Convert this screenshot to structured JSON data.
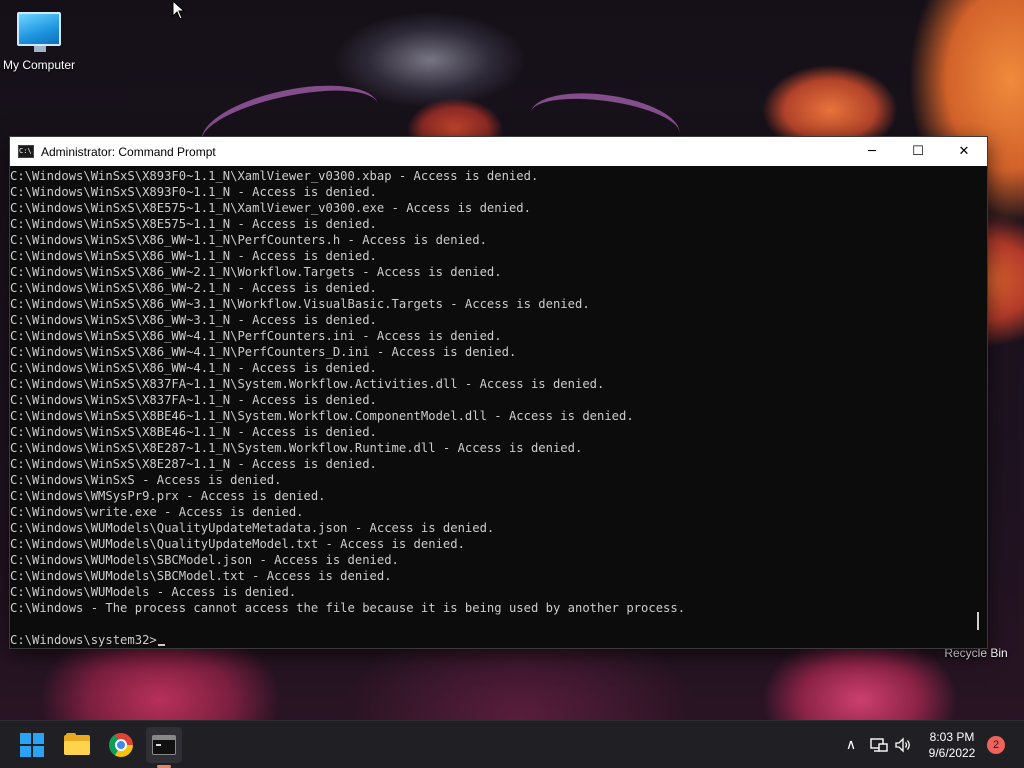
{
  "desktop": {
    "icons": [
      {
        "label": "My Computer"
      },
      {
        "label": "Recycle Bin"
      }
    ]
  },
  "window": {
    "title": "Administrator: Command Prompt",
    "icon_text": "C:\\",
    "controls": {
      "minimize": "─",
      "maximize": "☐",
      "close": "✕"
    }
  },
  "console": {
    "lines": [
      "C:\\Windows\\WinSxS\\X893F0~1.1_N\\XamlViewer_v0300.xbap - Access is denied.",
      "C:\\Windows\\WinSxS\\X893F0~1.1_N - Access is denied.",
      "C:\\Windows\\WinSxS\\X8E575~1.1_N\\XamlViewer_v0300.exe - Access is denied.",
      "C:\\Windows\\WinSxS\\X8E575~1.1_N - Access is denied.",
      "C:\\Windows\\WinSxS\\X86_WW~1.1_N\\PerfCounters.h - Access is denied.",
      "C:\\Windows\\WinSxS\\X86_WW~1.1_N - Access is denied.",
      "C:\\Windows\\WinSxS\\X86_WW~2.1_N\\Workflow.Targets - Access is denied.",
      "C:\\Windows\\WinSxS\\X86_WW~2.1_N - Access is denied.",
      "C:\\Windows\\WinSxS\\X86_WW~3.1_N\\Workflow.VisualBasic.Targets - Access is denied.",
      "C:\\Windows\\WinSxS\\X86_WW~3.1_N - Access is denied.",
      "C:\\Windows\\WinSxS\\X86_WW~4.1_N\\PerfCounters.ini - Access is denied.",
      "C:\\Windows\\WinSxS\\X86_WW~4.1_N\\PerfCounters_D.ini - Access is denied.",
      "C:\\Windows\\WinSxS\\X86_WW~4.1_N - Access is denied.",
      "C:\\Windows\\WinSxS\\X837FA~1.1_N\\System.Workflow.Activities.dll - Access is denied.",
      "C:\\Windows\\WinSxS\\X837FA~1.1_N - Access is denied.",
      "C:\\Windows\\WinSxS\\X8BE46~1.1_N\\System.Workflow.ComponentModel.dll - Access is denied.",
      "C:\\Windows\\WinSxS\\X8BE46~1.1_N - Access is denied.",
      "C:\\Windows\\WinSxS\\X8E287~1.1_N\\System.Workflow.Runtime.dll - Access is denied.",
      "C:\\Windows\\WinSxS\\X8E287~1.1_N - Access is denied.",
      "C:\\Windows\\WinSxS - Access is denied.",
      "C:\\Windows\\WMSysPr9.prx - Access is denied.",
      "C:\\Windows\\write.exe - Access is denied.",
      "C:\\Windows\\WUModels\\QualityUpdateMetadata.json - Access is denied.",
      "C:\\Windows\\WUModels\\QualityUpdateModel.txt - Access is denied.",
      "C:\\Windows\\WUModels\\SBCModel.json - Access is denied.",
      "C:\\Windows\\WUModels\\SBCModel.txt - Access is denied.",
      "C:\\Windows\\WUModels - Access is denied.",
      "C:\\Windows - The process cannot access the file because it is being used by another process."
    ],
    "prompt": "C:\\Windows\\system32>"
  },
  "taskbar": {
    "apps": [
      {
        "name": "start-button",
        "icon": "windows-logo-icon"
      },
      {
        "name": "file-explorer",
        "icon": "folder-icon"
      },
      {
        "name": "chrome",
        "icon": "chrome-icon"
      },
      {
        "name": "command-prompt",
        "icon": "terminal-icon",
        "active": true
      }
    ],
    "tray": {
      "chevron": "∧",
      "network": "⌨",
      "volume": "🔊"
    },
    "clock": {
      "time": "8:03 PM",
      "date": "9/6/2022"
    },
    "notification_count": "2"
  },
  "colors": {
    "console_bg": "#0c0c0c",
    "console_fg": "#cccccc",
    "taskbar_bg": "#1f1f24",
    "accent": "#e0876a"
  }
}
